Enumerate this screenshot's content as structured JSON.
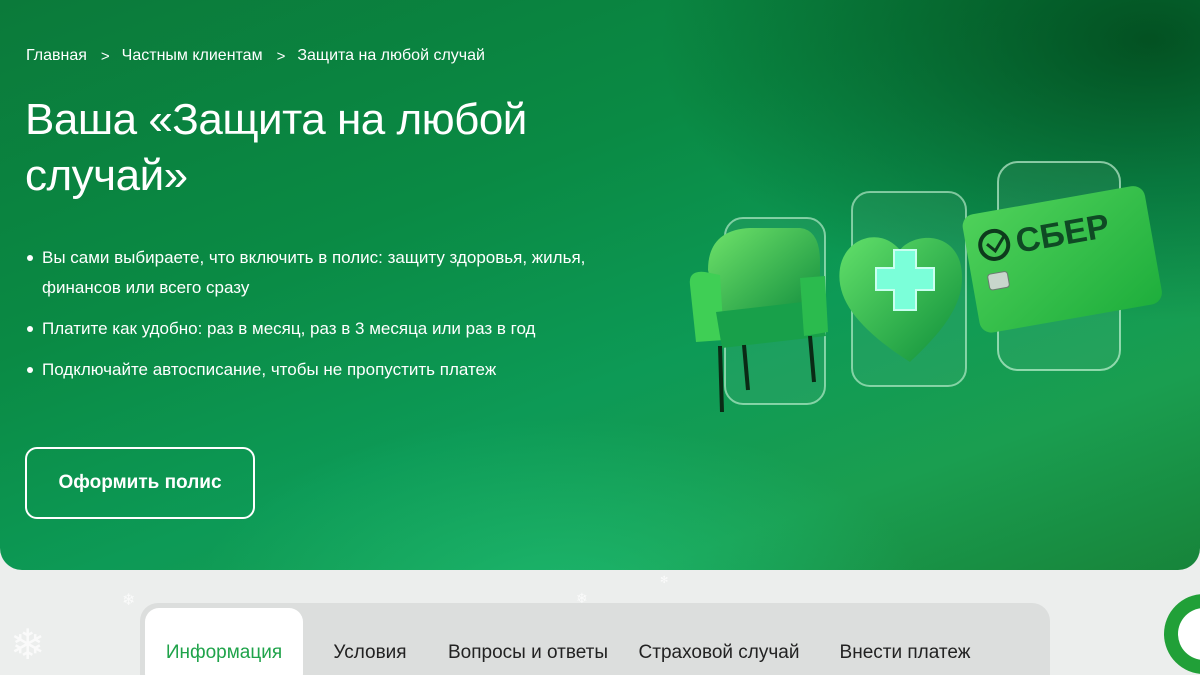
{
  "breadcrumb": {
    "home": "Главная",
    "private_clients": "Частным клиентам",
    "current": "Защита на любой случай",
    "separator": ">"
  },
  "hero": {
    "title": "Ваша «Защита на любой случай»",
    "bullets": [
      "Вы сами выбираете, что включить в полис: защиту здоровья, жилья, финансов или всего сразу",
      "Платите как удобно: раз в месяц, раз в 3 месяца или раз в год",
      "Подключайте автосписание, чтобы не пропустить платеж"
    ],
    "cta_label": "Оформить полис",
    "card_logo_text": "СБЕР"
  },
  "tabs": [
    {
      "label": "Информация",
      "active": true
    },
    {
      "label": "Условия",
      "active": false
    },
    {
      "label": "Вопросы и ответы",
      "active": false
    },
    {
      "label": "Страховой случай",
      "active": false
    },
    {
      "label": "Внести платеж",
      "active": false
    }
  ],
  "icons": {
    "armchair": "armchair-icon",
    "heart_cross": "heart-medical-icon",
    "bank_card": "bank-card-icon",
    "chat": "chat-assistant-icon",
    "snowflake": "snowflake-icon"
  },
  "colors": {
    "brand_green": "#21a038",
    "active_tab_text": "#1fa34a",
    "hero_dark": "#0b7a3a"
  }
}
